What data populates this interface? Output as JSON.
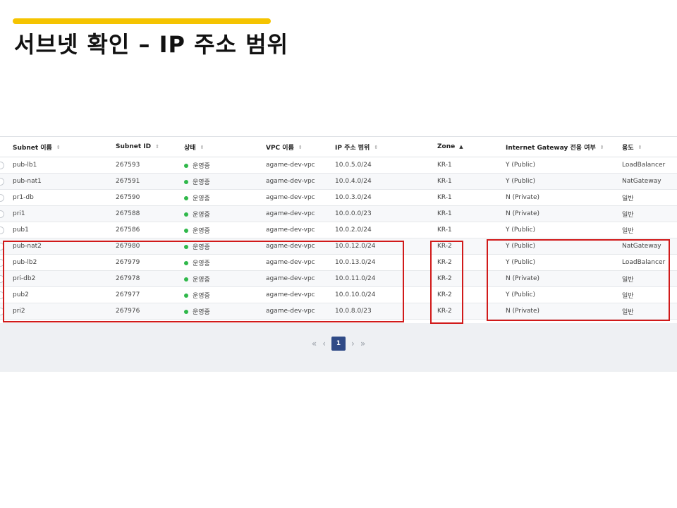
{
  "slide": {
    "title": "서브넷 확인 – IP 주소 범위",
    "accent_color": "#f5c400"
  },
  "table": {
    "columns": [
      {
        "label": "Subnet 이름",
        "sort": "none"
      },
      {
        "label": "Subnet ID",
        "sort": "none"
      },
      {
        "label": "상태",
        "sort": "none"
      },
      {
        "label": "VPC 이름",
        "sort": "none"
      },
      {
        "label": "IP 주소 범위",
        "sort": "none"
      },
      {
        "label": "Zone",
        "sort": "ascending"
      },
      {
        "label": "Internet Gateway 전용 여부",
        "sort": "none"
      },
      {
        "label": "용도",
        "sort": "none"
      }
    ],
    "rows": [
      {
        "name": "pub-lb1",
        "id": "267593",
        "status": "운영중",
        "vpc": "agame-dev-vpc",
        "cidr": "10.0.5.0/24",
        "zone": "KR-1",
        "igw": "Y (Public)",
        "usage": "LoadBalancer"
      },
      {
        "name": "pub-nat1",
        "id": "267591",
        "status": "운영중",
        "vpc": "agame-dev-vpc",
        "cidr": "10.0.4.0/24",
        "zone": "KR-1",
        "igw": "Y (Public)",
        "usage": "NatGateway"
      },
      {
        "name": "pr1-db",
        "id": "267590",
        "status": "운영중",
        "vpc": "agame-dev-vpc",
        "cidr": "10.0.3.0/24",
        "zone": "KR-1",
        "igw": "N (Private)",
        "usage": "일반"
      },
      {
        "name": "pri1",
        "id": "267588",
        "status": "운영중",
        "vpc": "agame-dev-vpc",
        "cidr": "10.0.0.0/23",
        "zone": "KR-1",
        "igw": "N (Private)",
        "usage": "일반"
      },
      {
        "name": "pub1",
        "id": "267586",
        "status": "운영중",
        "vpc": "agame-dev-vpc",
        "cidr": "10.0.2.0/24",
        "zone": "KR-1",
        "igw": "Y (Public)",
        "usage": "일반"
      },
      {
        "name": "pub-nat2",
        "id": "267980",
        "status": "운영중",
        "vpc": "agame-dev-vpc",
        "cidr": "10.0.12.0/24",
        "zone": "KR-2",
        "igw": "Y (Public)",
        "usage": "NatGateway"
      },
      {
        "name": "pub-lb2",
        "id": "267979",
        "status": "운영중",
        "vpc": "agame-dev-vpc",
        "cidr": "10.0.13.0/24",
        "zone": "KR-2",
        "igw": "Y (Public)",
        "usage": "LoadBalancer"
      },
      {
        "name": "pri-db2",
        "id": "267978",
        "status": "운영중",
        "vpc": "agame-dev-vpc",
        "cidr": "10.0.11.0/24",
        "zone": "KR-2",
        "igw": "N (Private)",
        "usage": "일반"
      },
      {
        "name": "pub2",
        "id": "267977",
        "status": "운영중",
        "vpc": "agame-dev-vpc",
        "cidr": "10.0.10.0/24",
        "zone": "KR-2",
        "igw": "Y (Public)",
        "usage": "일반"
      },
      {
        "name": "pri2",
        "id": "267976",
        "status": "운영중",
        "vpc": "agame-dev-vpc",
        "cidr": "10.0.8.0/23",
        "zone": "KR-2",
        "igw": "N (Private)",
        "usage": "일반"
      }
    ],
    "status_color": "#2fb84a",
    "highlight_color": "#d11a1a"
  },
  "pagination": {
    "first_icon": "double-chevron-left-icon",
    "prev_icon": "chevron-left-icon",
    "current_page": "1",
    "next_icon": "chevron-right-icon",
    "last_icon": "double-chevron-right-icon"
  }
}
